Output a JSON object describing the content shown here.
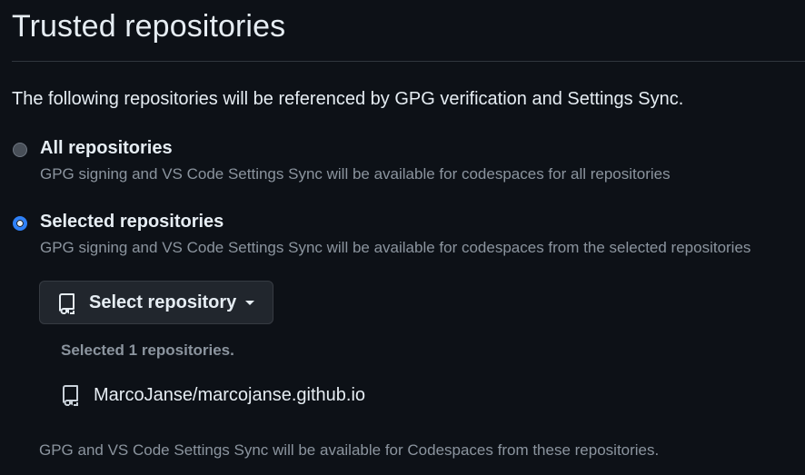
{
  "page": {
    "title": "Trusted repositories",
    "intro": "The following repositories will be referenced by GPG verification and Settings Sync."
  },
  "options": {
    "all": {
      "label": "All repositories",
      "description": "GPG signing and VS Code Settings Sync will be available for codespaces for all repositories",
      "selected": false
    },
    "selected": {
      "label": "Selected repositories",
      "description": "GPG signing and VS Code Settings Sync will be available for codespaces from the selected repositories",
      "selected": true
    }
  },
  "select_button": {
    "label": "Select repository",
    "icon": "repo-icon",
    "trailing_icon": "triangle-down-icon"
  },
  "selected_repos": {
    "count_text": "Selected 1 repositories.",
    "items": [
      {
        "name": "MarcoJanse/marcojanse.github.io",
        "icon": "repo-icon"
      }
    ]
  },
  "footer": {
    "note": "GPG and VS Code Settings Sync will be available for Codespaces from these repositories."
  },
  "colors": {
    "background": "#0d1117",
    "text": "#e6edf3",
    "muted": "#8b949e",
    "accent": "#2f81f7",
    "button_bg": "#21262d",
    "border": "#30363d"
  }
}
